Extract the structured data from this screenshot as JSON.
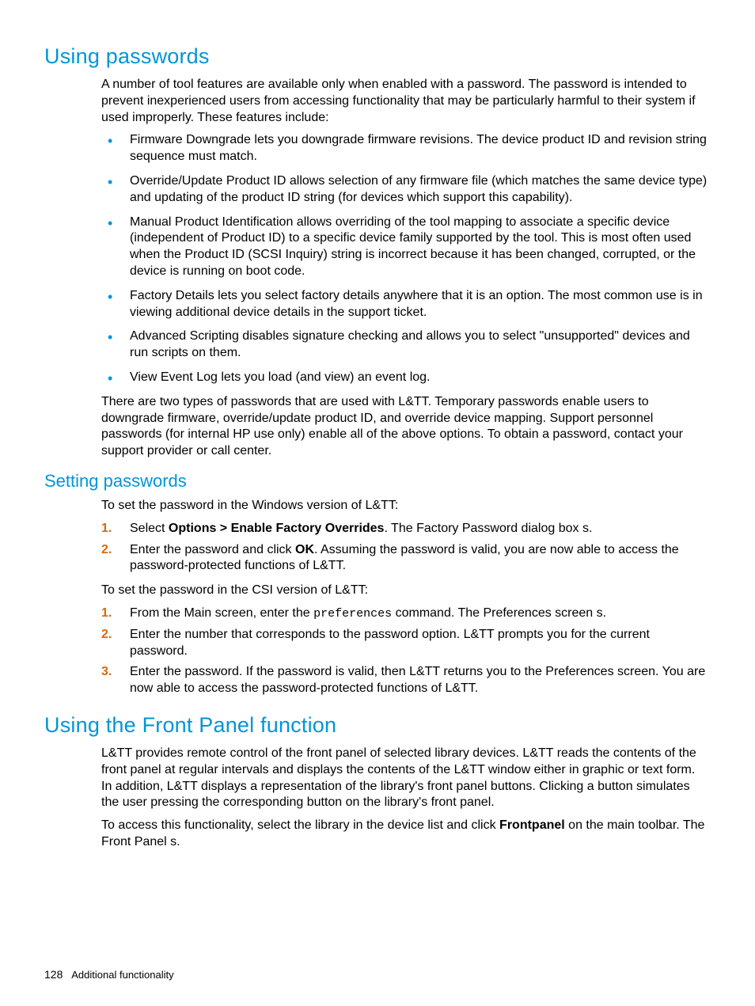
{
  "s1": {
    "heading": "Using passwords",
    "intro": "A number of tool features are available only when enabled with a password. The password is intended to prevent inexperienced users from accessing functionality that may be particularly harmful to their system if used improperly. These features include:",
    "bullets": [
      "Firmware Downgrade lets you downgrade firmware revisions. The device product ID and revision string sequence must match.",
      "Override/Update Product ID allows selection of any firmware file (which matches the same device type) and updating of the product ID string (for devices which support this capability).",
      "Manual Product Identification allows overriding of the tool mapping to associate a specific device (independent of Product ID) to a specific device family supported by the tool. This is most often used when the Product ID (SCSI Inquiry) string is incorrect because it has been changed, corrupted, or the device is running on boot code.",
      "Factory Details lets you select factory details anywhere that it is an option. The most common use is in viewing additional device details in the support ticket.",
      "Advanced Scripting disables signature checking and allows you to select \"unsupported\" devices and run scripts on them.",
      "View Event Log lets you load (and view) an event log."
    ],
    "outro": "There are two types of passwords that are used with L&TT. Temporary passwords enable users to downgrade firmware, override/update product ID, and override device mapping. Support personnel passwords (for internal HP use only) enable all of the above options. To obtain a password, contact your support provider or call center."
  },
  "s2": {
    "heading": "Setting passwords",
    "p1": "To set the password in the Windows version of L&TT:",
    "list1": {
      "i1_pre": "Select ",
      "i1_bold": "Options > Enable Factory Overrides",
      "i1_post": ". The Factory Password dialog box s.",
      "i2_pre": "Enter the password and click ",
      "i2_bold": "OK",
      "i2_post": ". Assuming the password is valid, you are now able to access the password-protected functions of L&TT."
    },
    "p2": "To set the password in the CSI version of L&TT:",
    "list2": {
      "i1_pre": "From the Main screen, enter the ",
      "i1_mono": "preferences",
      "i1_post": " command. The Preferences screen s.",
      "i2": "Enter the number that corresponds to the password option. L&TT prompts you for the current password.",
      "i3": "Enter the password. If the password is valid, then L&TT returns you to the Preferences screen. You are now able to access the password-protected functions of L&TT."
    }
  },
  "s3": {
    "heading": "Using the Front Panel function",
    "p1": "L&TT provides remote control of the front panel of selected library devices. L&TT reads the contents of the front panel at regular intervals and displays the contents of the L&TT window either in graphic or text form. In addition, L&TT displays a representation of the library's front panel buttons. Clicking a button simulates the user pressing the corresponding button on the library's front panel.",
    "p2_pre": "To access this functionality, select the library in the device list and click ",
    "p2_bold": "Frontpanel",
    "p2_post": " on the main toolbar. The Front Panel s."
  },
  "footer": {
    "page": "128",
    "title": "Additional functionality"
  }
}
